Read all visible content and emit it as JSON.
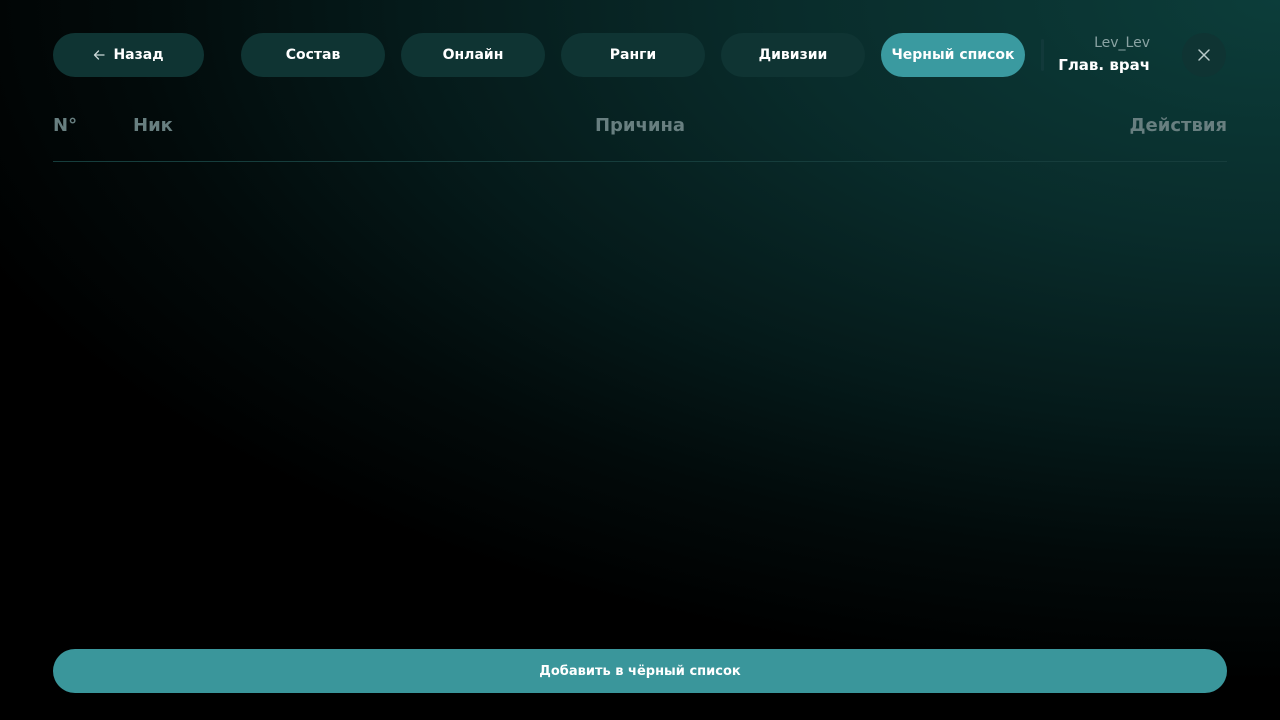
{
  "nav": {
    "back_label": "Назад",
    "tabs": [
      {
        "label": "Состав",
        "active": false
      },
      {
        "label": "Онлайн",
        "active": false
      },
      {
        "label": "Ранги",
        "active": false
      },
      {
        "label": "Дивизии",
        "active": false
      },
      {
        "label": "Черный список",
        "active": true
      }
    ],
    "back_icon": "arrow-left-icon",
    "close_icon": "close-icon"
  },
  "user": {
    "name": "Lev_Lev",
    "role": "Глав. врач"
  },
  "table": {
    "columns": [
      "N°",
      "Ник",
      "Причина",
      "Действия"
    ],
    "rows": []
  },
  "footer": {
    "add_label": "Добавить в чёрный список"
  },
  "colors": {
    "accent": "#3a9aa0",
    "pill": "#0f3433",
    "header_text": "#687f80"
  }
}
